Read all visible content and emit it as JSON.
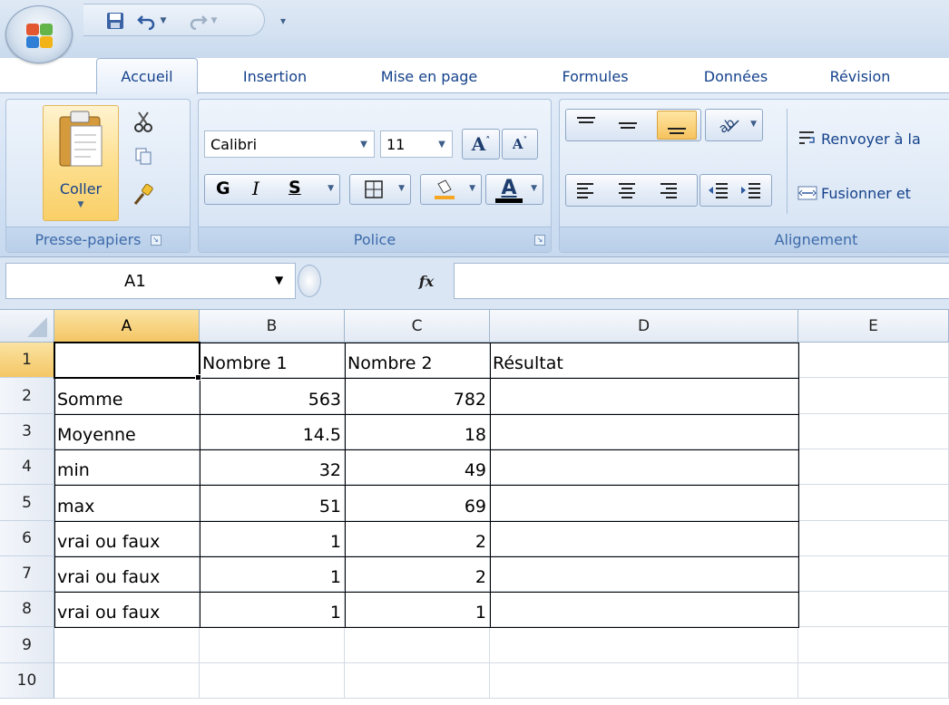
{
  "title_bar": {
    "office_button": "Office",
    "quick_access": {
      "save": "Enregistrer",
      "undo": "Annuler",
      "redo": "Rétablir",
      "customize": "Personnaliser"
    }
  },
  "tabs": [
    {
      "label": "Accueil",
      "active": true
    },
    {
      "label": "Insertion",
      "active": false
    },
    {
      "label": "Mise en page",
      "active": false
    },
    {
      "label": "Formules",
      "active": false
    },
    {
      "label": "Données",
      "active": false
    },
    {
      "label": "Révision",
      "active": false
    }
  ],
  "ribbon": {
    "clipboard": {
      "label": "Presse-papiers",
      "paste_label": "Coller"
    },
    "font": {
      "label": "Police",
      "font_name": "Calibri",
      "font_size": "11",
      "bold": "G",
      "italic": "I",
      "underline": "S",
      "font_color_letter": "A"
    },
    "alignment": {
      "label": "Alignement",
      "wrap_text": "Renvoyer à la",
      "merge": "Fusionner et"
    }
  },
  "formula_bar": {
    "name_box": "A1",
    "fx": "fx",
    "formula": ""
  },
  "sheet": {
    "columns": [
      "A",
      "B",
      "C",
      "D",
      "E"
    ],
    "selected_column": "A",
    "selected_row": "1",
    "rows": [
      {
        "num": "1",
        "cells": [
          "",
          "Nombre 1",
          "Nombre 2",
          "Résultat",
          ""
        ]
      },
      {
        "num": "2",
        "cells": [
          "Somme",
          "563",
          "782",
          "",
          ""
        ]
      },
      {
        "num": "3",
        "cells": [
          "Moyenne",
          "14.5",
          "18",
          "",
          ""
        ]
      },
      {
        "num": "4",
        "cells": [
          "min",
          "32",
          "49",
          "",
          ""
        ]
      },
      {
        "num": "5",
        "cells": [
          "max",
          "51",
          "69",
          "",
          ""
        ]
      },
      {
        "num": "6",
        "cells": [
          "vrai ou faux",
          "1",
          "2",
          "",
          ""
        ]
      },
      {
        "num": "7",
        "cells": [
          "vrai ou faux",
          "1",
          "2",
          "",
          ""
        ]
      },
      {
        "num": "8",
        "cells": [
          "vrai ou faux",
          "1",
          "1",
          "",
          ""
        ]
      },
      {
        "num": "9",
        "cells": [
          "",
          "",
          "",
          "",
          ""
        ]
      },
      {
        "num": "10",
        "cells": [
          "",
          "",
          "",
          "",
          ""
        ]
      }
    ]
  },
  "colors": {
    "ribbon_text": "#15428b",
    "selected_header": "#f4c665",
    "grid_line": "#d4dbe5"
  }
}
